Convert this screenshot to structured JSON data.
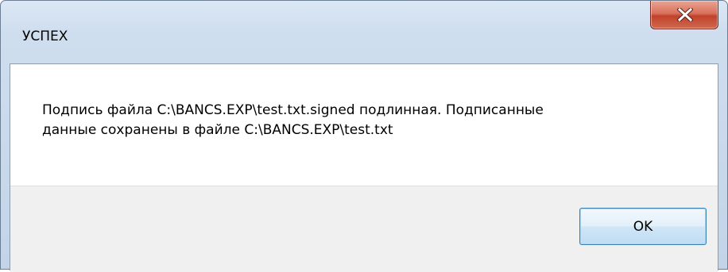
{
  "window": {
    "title": "УСПЕХ"
  },
  "titlebar": {
    "close_icon": "close-icon"
  },
  "message": {
    "line1": "Подпись файла C:\\BANCS.EXP\\test.txt.signed подлинная. Подписанные",
    "line2": "данные сохранены в файле C:\\BANCS.EXP\\test.txt"
  },
  "buttons": {
    "ok_label": "OK"
  },
  "colors": {
    "close_button": "#c7503a",
    "ok_border": "#3c7fb1",
    "footer_bg": "#f0f0f0",
    "frame": "#c3d4e8"
  }
}
